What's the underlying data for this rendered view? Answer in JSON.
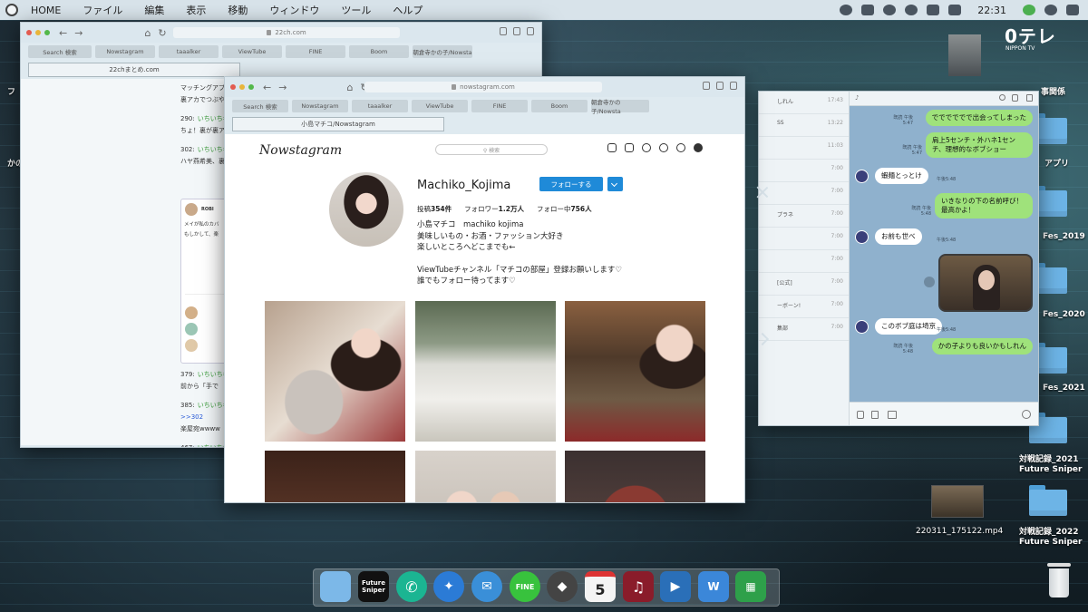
{
  "menubar": {
    "items": [
      "HOME",
      "ファイル",
      "編集",
      "表示",
      "移動",
      "ウィンドウ",
      "ツール",
      "ヘルプ"
    ],
    "clock": "22:31"
  },
  "browser_tabs": [
    "Search 検索",
    "Nowstagram",
    "taaalker",
    "ViewTube",
    "FINE",
    "Boom",
    "朝倉寺かの子/Nowsta"
  ],
  "win22": {
    "url": "22ch.com",
    "page_tab": "22chまとめ.com",
    "lines": [
      {
        "type": "text",
        "text": "マッチングアプリでつぶやいてたアレか…"
      },
      {
        "type": "text",
        "text": "裏アカでつぶやいて"
      },
      {
        "type": "gap"
      },
      {
        "type": "post",
        "num": "290:",
        "name": "いちいち名無"
      },
      {
        "type": "text",
        "text": "ちょ！裏が裏アカ"
      },
      {
        "type": "gap"
      },
      {
        "type": "post",
        "num": "302:",
        "name": "いちいち名無"
      },
      {
        "type": "text",
        "text": "ハヤ燕希美、裏ア"
      }
    ],
    "tweet": {
      "user": "ROBI",
      "text1": "メイが私のカバ",
      "text2": "もしかして、楽"
    },
    "lines2": [
      {
        "type": "post",
        "num": "379:",
        "name": "いちいち名無"
      },
      {
        "type": "text",
        "text": "前から「手で"
      },
      {
        "type": "gap"
      },
      {
        "type": "post",
        "num": "385:",
        "name": "いちいち名無"
      },
      {
        "type": "link",
        "text": ">>302"
      },
      {
        "type": "text",
        "text": "楽屋宛wwww"
      },
      {
        "type": "gap"
      },
      {
        "type": "post",
        "num": "467:",
        "name": "いちいち名無"
      }
    ]
  },
  "chat": {
    "list_times": [
      "17:43",
      "13:22",
      "11:03",
      "7:00",
      "7:00",
      "7:00",
      "7:00",
      "7:00",
      "7:00",
      "7:00",
      "7:00"
    ],
    "list_snips": [
      "しれん",
      "SS",
      "",
      "",
      "",
      "プラネ",
      "",
      "",
      "[公式]",
      "ーボーン!",
      "集部"
    ],
    "messages": [
      {
        "from": "me",
        "text": "でででででで出会ってしまった",
        "meta": "既読 午後5:47"
      },
      {
        "from": "me",
        "text": "肩上5センチ・外ハネ1センチ、理想的なボブショー",
        "meta": "既読 午後5:47"
      },
      {
        "from": "them",
        "text": "蝦麺とっとけ",
        "meta": "午後5:48"
      },
      {
        "from": "me",
        "text": "いきなりの下の名前呼び！最高かよ！",
        "meta": "既読 午後5:48"
      },
      {
        "from": "them",
        "text": "お前も世べ",
        "meta": "午後5:48"
      },
      {
        "from": "them",
        "text": "このボブ庭は埼京",
        "meta": "午後5:48"
      },
      {
        "from": "me",
        "text": "かの子よりも良いかもしれん",
        "meta": "既読 午後5:48"
      }
    ]
  },
  "nowstagram": {
    "url": "nowstagram.com",
    "page_tab": "小島マチコ/Nowstagram",
    "logo": "Nowstagram",
    "search_placeholder": "⚲ 検索",
    "username": "Machiko_Kojima",
    "follow_label": "フォローする",
    "stats": [
      {
        "label": "投稿",
        "value": "354件"
      },
      {
        "label": "フォロワー",
        "value": "1.2万人"
      },
      {
        "label": "フォロー中",
        "value": "756人"
      }
    ],
    "bio": [
      "小島マチコ　machiko kojima",
      "美味しいもの・お酒・ファッション大好き",
      "楽しいところへどこまでも←",
      "",
      "ViewTubeチャンネル「マチコの部屋」登録お願いします♡",
      "誰でもフォロー待ってます♡"
    ]
  },
  "desktop": {
    "brand": "0テレ",
    "brand_sub": "NIPPON TV",
    "labels": {
      "fes2019": "Fes_2019",
      "fes2020": "Fes_2020",
      "fes2021": "Fes_2021",
      "sniper2021a": "対戦記録_2021",
      "sniper2021b": "Future Sniper",
      "video": "220311_175122.mp4",
      "sniper2022a": "対戦記録_2022",
      "sniper2022b": "Future Sniper",
      "rel": "事関係",
      "app": "アプリ",
      "left1": "フ",
      "left2": "かの"
    }
  },
  "dock": {
    "future_sniper": "Future Sniper",
    "fine": "FINE",
    "calendar": "5"
  },
  "colors": {
    "accent": "#1f8ad8",
    "chat_bg": "#8fb1cd",
    "bubble_me": "#9fe27b",
    "folder": "#6db4e6"
  }
}
